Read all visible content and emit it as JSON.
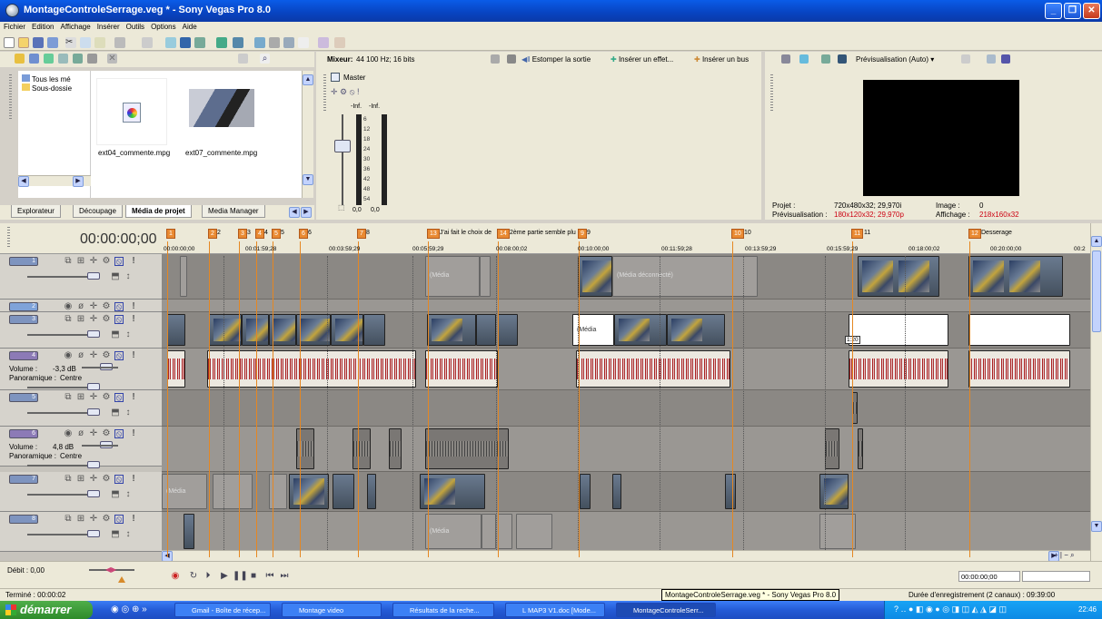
{
  "window": {
    "title": "MontageControleSerrage.veg * - Sony Vegas Pro 8.0"
  },
  "menu": [
    "Fichier",
    "Edition",
    "Affichage",
    "Insérer",
    "Outils",
    "Options",
    "Aide"
  ],
  "explorer": {
    "tree": [
      "Tous les mé",
      "Sous-dossie"
    ],
    "files": [
      {
        "name": "ext04_commente.mpg",
        "icon": "media-file-icon"
      },
      {
        "name": "ext07_commente.mpg",
        "icon": "video-thumbnail"
      }
    ],
    "tabs": [
      "Explorateur",
      "Découpage",
      "Média de projet",
      "Media Manager"
    ],
    "active_tab": "Média de projet"
  },
  "mixer": {
    "header_label": "Mixeur:",
    "header_value": "44 100 Hz; 16 bits",
    "master_label": "Master",
    "peak_left": "-Inf.",
    "peak_right": "-Inf.",
    "scale": [
      "6",
      "12",
      "18",
      "24",
      "30",
      "36",
      "42",
      "48",
      "54"
    ],
    "bottom_left": "0,0",
    "bottom_right": "0,0",
    "buttons": [
      "Estomper la sortie",
      "Insérer un effet...",
      "Insérer un bus"
    ]
  },
  "preview": {
    "mode": "Prévisualisation (Auto)",
    "projet_label": "Projet :",
    "projet_value": "720x480x32; 29,970i",
    "previs_label": "Prévisualisation :",
    "previs_value": "180x120x32; 29,970p",
    "image_label": "Image :",
    "image_value": "0",
    "affichage_label": "Affichage :",
    "affichage_value": "218x160x32"
  },
  "timeline": {
    "timecode": "00:00:00;00",
    "ruler": [
      "00:00:00;00",
      "00:01:59;28",
      "00:03:59;29",
      "00:05:59;29",
      "00:08:00;02",
      "00:10:00;00",
      "00:11:59;28",
      "00:13:59;29",
      "00:15:59;29",
      "00:18:00;02",
      "00:20:00;00",
      "00:2"
    ],
    "markers": [
      {
        "num": "1",
        "text": ""
      },
      {
        "num": "2",
        "text": "2"
      },
      {
        "num": "3",
        "text": "3"
      },
      {
        "num": "4",
        "text": "4"
      },
      {
        "num": "5",
        "text": "5"
      },
      {
        "num": "6",
        "text": "6"
      },
      {
        "num": "7",
        "text": "8"
      },
      {
        "num": "13",
        "text": "J'ai fait le choix de"
      },
      {
        "num": "14",
        "text": "2ème partie semble plu"
      },
      {
        "num": "9",
        "text": "9"
      },
      {
        "num": "10",
        "text": "10"
      },
      {
        "num": "11",
        "text": "11"
      },
      {
        "num": "12",
        "text": "Desserage"
      }
    ],
    "tracks": [
      {
        "num": "1",
        "type": "video"
      },
      {
        "num": "2",
        "type": "audio"
      },
      {
        "num": "3",
        "type": "video"
      },
      {
        "num": "4",
        "type": "audio",
        "volume_label": "Volume :",
        "volume": "-3,3 dB",
        "pan_label": "Panoramique :",
        "pan": "Centre"
      },
      {
        "num": "5",
        "type": "video"
      },
      {
        "num": "6",
        "type": "audio",
        "volume_label": "Volume :",
        "volume": "4,8 dB",
        "pan_label": "Panoramique :",
        "pan": "Centre"
      },
      {
        "num": "7",
        "type": "video"
      },
      {
        "num": "8",
        "type": "video"
      }
    ],
    "offline_label": "(Média déconnecté)",
    "offline_short": "(Média",
    "clip_badge": "1:20"
  },
  "transport": {
    "debit": "Débit : 0,00",
    "timecode_right": "00:00:00;00"
  },
  "status": {
    "left": "Terminé : 00:00:02",
    "tooltip": "MontageControleSerrage.veg * - Sony Vegas Pro 8.0",
    "right": "Durée d'enregistrement (2 canaux) : 09:39:00"
  },
  "taskbar": {
    "start": "démarrer",
    "buttons": [
      "Gmail - Boîte de récep...",
      "Montage video",
      "Résultats de la reche...",
      "L MAP3 V1.doc [Mode...",
      "MontageControleSerr..."
    ],
    "clock": "22:46"
  },
  "colors": {
    "titlebar": "#0843c0",
    "marker": "#e98a32",
    "taskbar": "#245bd6"
  }
}
